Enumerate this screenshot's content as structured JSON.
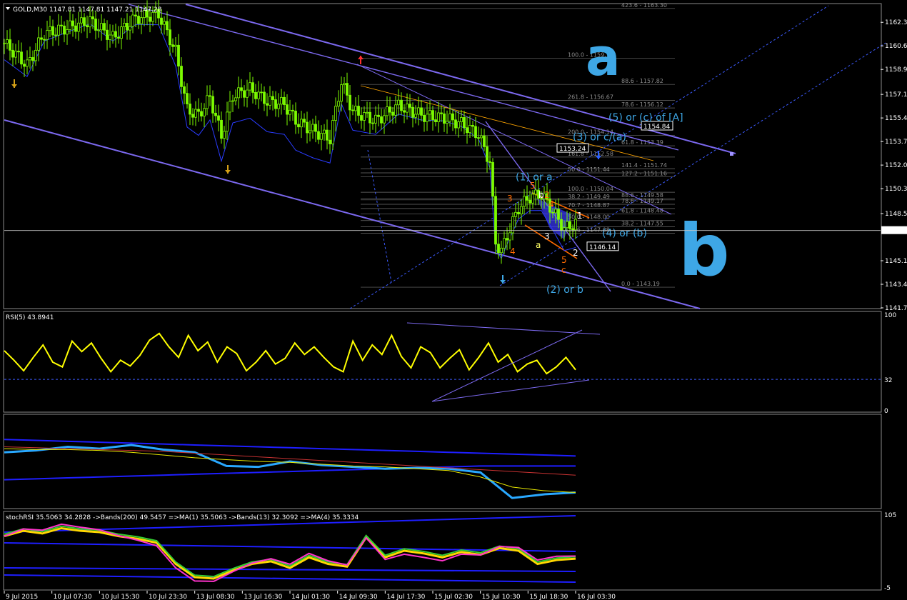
{
  "window": {
    "symbol_header": "GOLD,M30  1147.81 1147.81 1147.21 1147.28"
  },
  "colors": {
    "background": "#000000",
    "candles": "#7cfc00",
    "channel": "#7b68ee",
    "price_line": "#c8c8c8",
    "rsi_line": "#ffff00",
    "ind_blue": "#29a8ff",
    "ind_band": "#1e1eff",
    "marker_green": "#0a8a1e",
    "wave_blue": "#3ea7e6",
    "wave_orange": "#ff6a00",
    "fib_line": "#6e6e6e"
  },
  "chart_data": [
    {
      "type": "candlestick",
      "symbol": "GOLD",
      "timeframe": "M30",
      "ohlc_header": {
        "open": 1147.81,
        "high": 1147.81,
        "low": 1147.21,
        "close": 1147.28
      },
      "ylim": [
        1141.7,
        1163.6
      ],
      "y_ticks": [
        1162.3,
        1160.6,
        1158.9,
        1157.1,
        1155.4,
        1153.7,
        1152.0,
        1150.3,
        1148.5,
        1145.1,
        1143.4,
        1141.7
      ],
      "current_price": "1147.28",
      "x_tick_labels": [
        "9 Jul 2015",
        "10 Jul 07:30",
        "10 Jul 15:30",
        "10 Jul 23:30",
        "13 Jul 08:30",
        "13 Jul 16:30",
        "14 Jul 01:30",
        "14 Jul 09:30",
        "14 Jul 17:30",
        "15 Jul 02:30",
        "15 Jul 10:30",
        "15 Jul 18:30",
        "16 Jul 03:30"
      ],
      "close_path": [
        [
          0,
          1160.8
        ],
        [
          8,
          1159.2
        ],
        [
          14,
          1161.5
        ],
        [
          22,
          1161.9
        ],
        [
          30,
          1162.4
        ],
        [
          38,
          1161.2
        ],
        [
          46,
          1162.6
        ],
        [
          54,
          1162.9
        ],
        [
          60,
          1160.2
        ],
        [
          64,
          1156.0
        ],
        [
          68,
          1155.6
        ],
        [
          72,
          1156.9
        ],
        [
          76,
          1154.1
        ],
        [
          80,
          1157.0
        ],
        [
          86,
          1157.5
        ],
        [
          92,
          1156.6
        ],
        [
          98,
          1156.4
        ],
        [
          102,
          1155.2
        ],
        [
          108,
          1154.5
        ],
        [
          114,
          1153.9
        ],
        [
          118,
          1158.0
        ],
        [
          122,
          1155.9
        ],
        [
          130,
          1155.2
        ],
        [
          138,
          1156.3
        ],
        [
          146,
          1155.6
        ],
        [
          154,
          1155.4
        ],
        [
          160,
          1155.0
        ],
        [
          166,
          1154.2
        ],
        [
          170,
          1152.2
        ],
        [
          172,
          1146.4
        ],
        [
          174,
          1145.8
        ],
        [
          176,
          1146.9
        ],
        [
          180,
          1148.9
        ],
        [
          184,
          1149.7
        ],
        [
          188,
          1149.9
        ],
        [
          192,
          1148.7
        ],
        [
          196,
          1147.4
        ],
        [
          200,
          1147.8
        ]
      ],
      "fibonacci_levels": [
        {
          "label": "423.6 - 1163.30",
          "price": 1163.3
        },
        {
          "label": "100.0 - 1159.70",
          "price": 1159.7
        },
        {
          "label": "88.6 - 1157.82",
          "price": 1157.82
        },
        {
          "label": "261.8 - 1156.67",
          "price": 1156.67
        },
        {
          "label": "78.6 - 1156.12",
          "price": 1156.12
        },
        {
          "label": "200.0 - 1154.14",
          "price": 1154.14
        },
        {
          "label": "61.8 - 1153.39",
          "price": 1153.39
        },
        {
          "label": "161.8 - 1152.58",
          "price": 1152.58
        },
        {
          "label": "141.4 - 1151.74",
          "price": 1151.74
        },
        {
          "label": "50.0 - 1151.44",
          "price": 1151.44
        },
        {
          "label": "127.2 - 1151.16",
          "price": 1151.16
        },
        {
          "label": "100.0 - 1150.04",
          "price": 1150.04
        },
        {
          "label": "88.6 - 1149.58",
          "price": 1149.58
        },
        {
          "label": "38.2 - 1149.49",
          "price": 1149.49
        },
        {
          "label": "78.6 - 1149.17",
          "price": 1149.17
        },
        {
          "label": "70.7 - 1148.87",
          "price": 1148.87
        },
        {
          "label": "61.8 - 1148.48",
          "price": 1148.48
        },
        {
          "label": "50.0 - 1148.00",
          "price": 1148.0
        },
        {
          "label": "38.2 - 1147.55",
          "price": 1147.55
        },
        {
          "label": "23.6 - 1147.08",
          "price": 1147.08
        },
        {
          "label": "0.0 - 1143.19",
          "price": 1143.19
        }
      ],
      "price_boxes": [
        {
          "label": "1154.84",
          "price": 1154.84
        },
        {
          "label": "1153.24",
          "price": 1153.24
        },
        {
          "label": "1146.14",
          "price": 1146.14
        }
      ],
      "wave_labels": {
        "w5_c_a": "(5) or (c) of [A]",
        "w3_c_a": "(3) or c/(a)",
        "w1_or_a": "(1) or a",
        "w4_or_b": "(4) or (b)",
        "w2_or_b": "(2) or b",
        "small": [
          "3",
          "4",
          "5",
          "b",
          "2",
          "4",
          "1",
          "3",
          "a",
          "5",
          "2",
          "c"
        ]
      },
      "annotations_handwritten": [
        "a",
        "b"
      ]
    },
    {
      "type": "line",
      "title": "RSI(5) 43.8941",
      "ylim": [
        0,
        100
      ],
      "y_ticks": [
        100,
        32,
        0
      ],
      "level": 32,
      "values": [
        62,
        52,
        41,
        55,
        68,
        50,
        45,
        72,
        61,
        70,
        54,
        40,
        52,
        46,
        57,
        73,
        80,
        66,
        55,
        78,
        62,
        71,
        50,
        66,
        59,
        41,
        50,
        62,
        48,
        54,
        70,
        58,
        66,
        55,
        45,
        40,
        72,
        52,
        68,
        58,
        78,
        56,
        44,
        66,
        60,
        44,
        54,
        63,
        42,
        55,
        70,
        50,
        58,
        40,
        48,
        52,
        38,
        45,
        55,
        42
      ]
    },
    {
      "type": "line",
      "title": "",
      "series": [
        {
          "values": [
            60,
            62,
            66,
            64,
            68,
            63,
            60,
            45,
            44,
            50,
            46,
            44,
            42,
            43,
            42,
            38,
            10,
            14,
            16
          ]
        },
        {
          "values": [
            66,
            65,
            64,
            63,
            62,
            61,
            59,
            57,
            55,
            53,
            51,
            49,
            47,
            45,
            43,
            41,
            39,
            37,
            35
          ]
        },
        {
          "values": [
            64,
            63,
            63,
            62,
            60,
            57,
            54,
            52,
            50,
            49,
            47,
            45,
            44,
            42,
            40,
            33,
            22,
            18,
            16
          ]
        }
      ],
      "bands": {
        "upper": [
          74,
          73,
          72,
          71,
          70,
          69,
          68,
          67,
          66,
          65,
          64,
          63,
          62,
          61,
          60,
          59,
          58,
          57,
          56
        ],
        "lower": [
          30,
          31,
          32,
          33,
          34,
          35,
          36,
          37,
          38,
          39,
          40,
          41,
          42,
          43,
          44,
          45,
          45,
          45,
          45
        ]
      }
    },
    {
      "type": "line",
      "title": "stochRSI 35.5063 34.2828  ->Bands(200) 49.5457  =>MA(1) 35.5063  ->Bands(13) 32.3092  =>MA(4) 35.3334",
      "ylim": [
        -5,
        105
      ],
      "y_ticks": [
        105,
        -5
      ],
      "values": [
        72,
        80,
        76,
        84,
        80,
        78,
        72,
        68,
        62,
        30,
        10,
        8,
        20,
        30,
        34,
        24,
        40,
        30,
        26,
        70,
        40,
        50,
        46,
        40,
        48,
        44,
        54,
        50,
        30,
        36,
        38
      ]
    }
  ]
}
